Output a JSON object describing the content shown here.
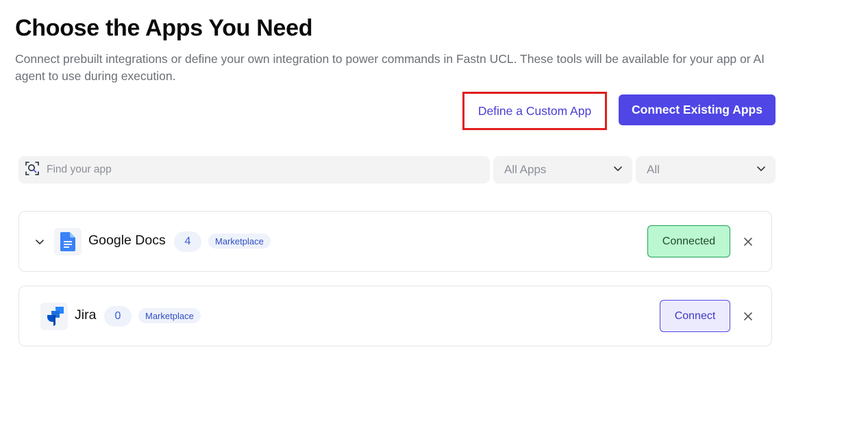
{
  "header": {
    "title": "Choose the Apps You Need",
    "subtitle": "Connect prebuilt integrations or define your own integration to power commands in Fastn UCL. These tools will be available for your app or AI agent to use during execution."
  },
  "actions": {
    "define_custom": "Define a Custom App",
    "connect_existing": "Connect Existing Apps"
  },
  "filters": {
    "search_placeholder": "Find your app",
    "category_selected": "All Apps",
    "status_selected": "All"
  },
  "apps": [
    {
      "name": "Google Docs",
      "icon": "google-docs-icon",
      "count": "4",
      "badge": "Marketplace",
      "status_label": "Connected",
      "expandable": true
    },
    {
      "name": "Jira",
      "icon": "jira-icon",
      "count": "0",
      "badge": "Marketplace",
      "status_label": "Connect",
      "expandable": false
    }
  ],
  "colors": {
    "accent": "#4f46e5",
    "highlight_border": "#e11d1d",
    "connected_bg": "#bbf7d0",
    "connected_border": "#22a05a"
  }
}
